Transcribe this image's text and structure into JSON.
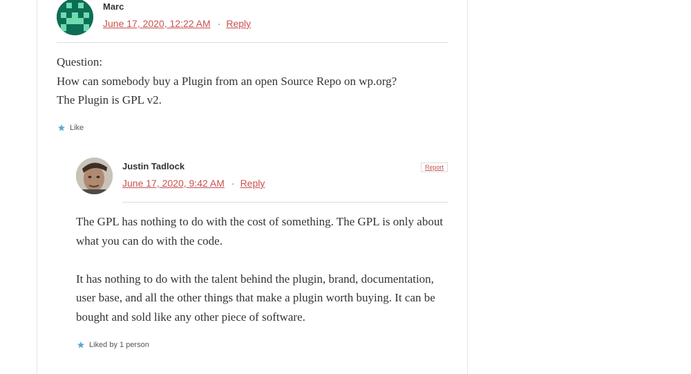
{
  "comments": [
    {
      "author": "Marc",
      "date": "June 17, 2020, 12:22 AM",
      "separator": "·",
      "reply_label": "Reply",
      "paragraphs": [
        "Question:\nHow can somebody buy a Plugin from an open Source Repo on wp.org?\nThe Plugin is GPL v2."
      ],
      "like_label": "Like"
    },
    {
      "author": "Justin Tadlock",
      "date": "June 17, 2020, 9:42 AM",
      "separator": "·",
      "reply_label": "Reply",
      "report_label": "Report",
      "paragraphs": [
        "The GPL has nothing to do with the cost of something. The GPL is only about what you can do with the code.",
        "It has nothing to do with the talent behind the plugin, brand, documentation, user base, and all the other things that make a plugin worth buying. It can be bought and sold like any other piece of software."
      ],
      "like_label": "Liked by 1 person"
    }
  ],
  "icons": {
    "like": "star-icon",
    "avatar_marc": "identicon-avatar",
    "avatar_justin": "user-photo-avatar"
  },
  "colors": {
    "link": "#c9514f",
    "star": "#5fa8d3",
    "identicon_bg": "#0e6e55",
    "identicon_fg": "#6fdcb0"
  }
}
